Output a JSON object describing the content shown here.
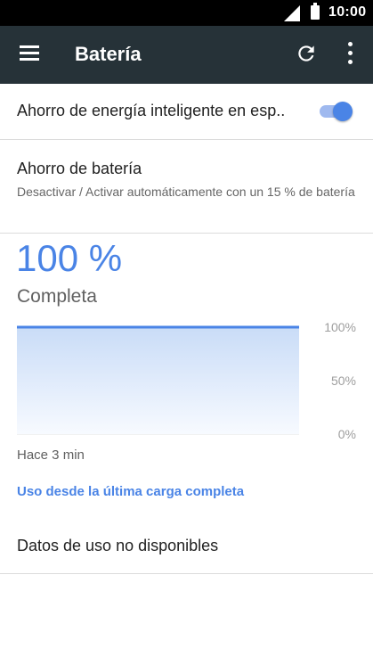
{
  "status_bar": {
    "time": "10:00",
    "icons": [
      "cell-signal-icon",
      "battery-icon"
    ]
  },
  "toolbar": {
    "title": "Batería",
    "icons": [
      "menu-icon",
      "refresh-icon",
      "more-vert-icon"
    ],
    "background": "#263238"
  },
  "smart_saving": {
    "label": "Ahorro de energía inteligente en esp..",
    "enabled": true
  },
  "battery_saver": {
    "label": "Ahorro de batería",
    "summary": "Desactivar / Activar automáticamente con un 15 % de batería"
  },
  "battery": {
    "level_text": "100 %",
    "status": "Completa",
    "accent": "#4a84e6"
  },
  "chart_data": {
    "type": "area",
    "x": [
      0,
      1
    ],
    "values": [
      100,
      100
    ],
    "ylim": [
      0,
      100
    ],
    "y_tick_labels": [
      "100%",
      "50%",
      "0%"
    ],
    "y_ticks": [
      100,
      50,
      0
    ],
    "grid": true,
    "x_label_start": "Hace 3 min",
    "color": "#4a84e6"
  },
  "usage_link": "Uso desde la última carga completa",
  "no_data": "Datos de uso no disponibles"
}
